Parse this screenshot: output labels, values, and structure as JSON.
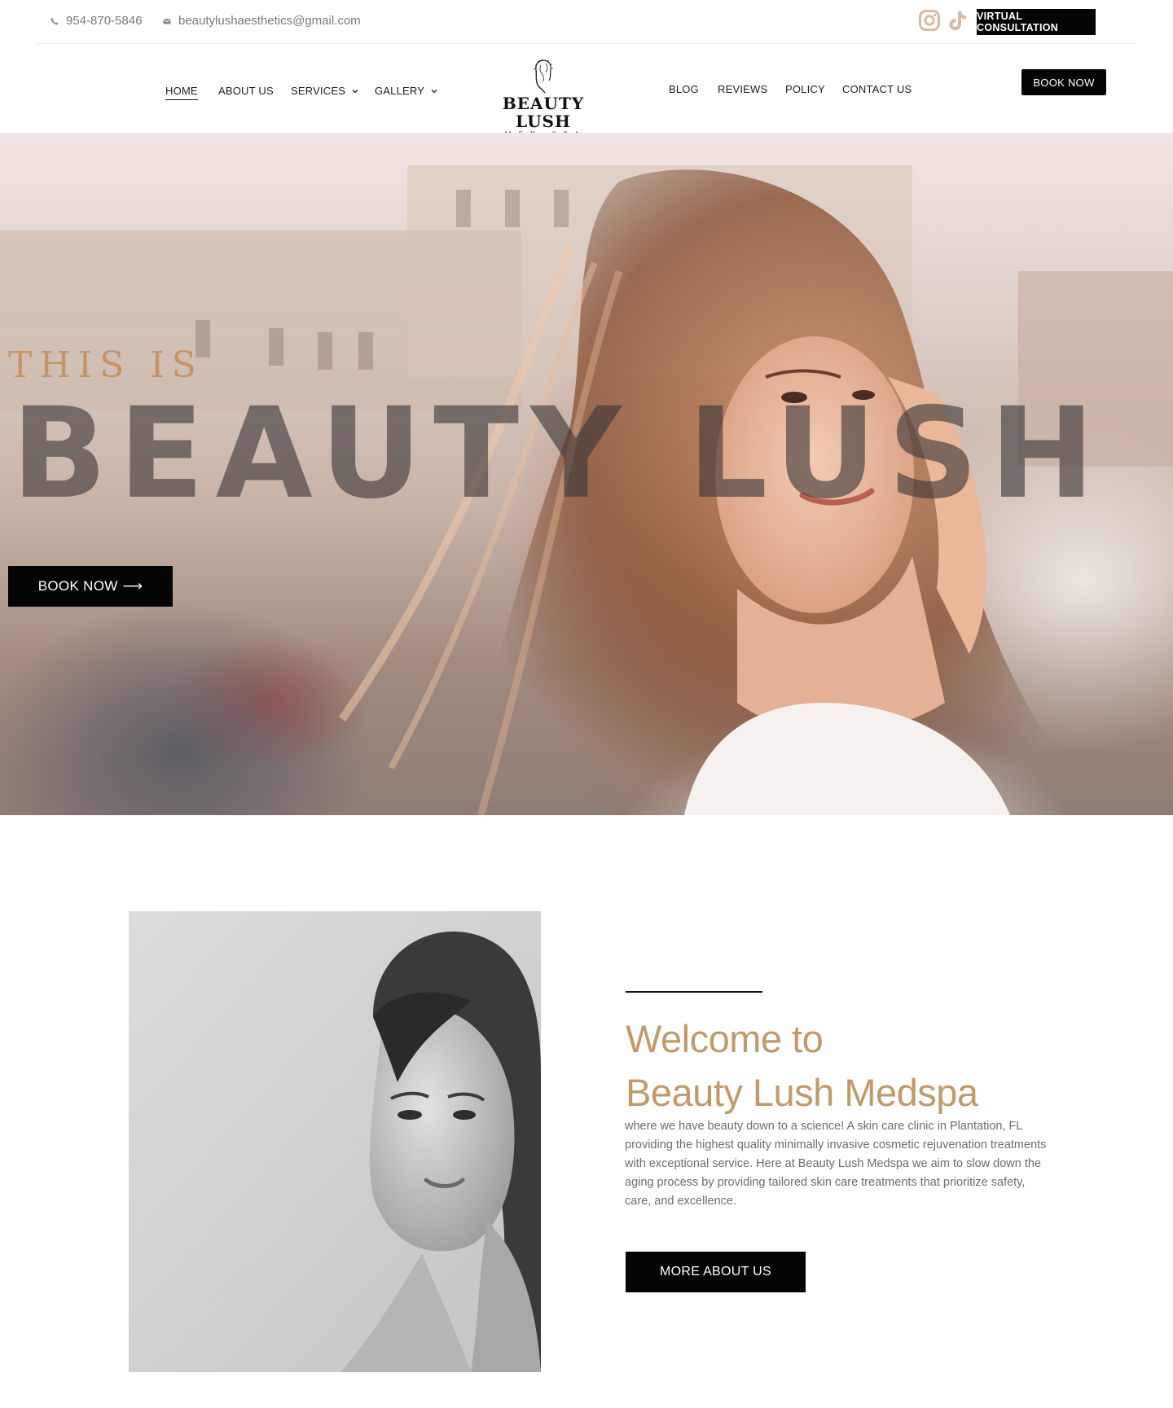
{
  "topbar": {
    "phone": "954-870-5846",
    "email": "beautylushaesthetics@gmail.com",
    "social_icons": [
      "instagram-icon",
      "tiktok-icon"
    ],
    "social_color": "#d9b9a3",
    "virtual_consultation_label": "VIRTUAL CONSULTATION"
  },
  "nav": {
    "home": "HOME",
    "about": "ABOUT US",
    "services": "SERVICES",
    "gallery": "GALLERY",
    "blog": "BLOG",
    "reviews": "REVIEWS",
    "policy": "POLICY",
    "contact": "CONTACT US",
    "book_now": "BOOK NOW"
  },
  "logo": {
    "name": "BEAUTY LUSH",
    "sub": "MED SPA"
  },
  "hero": {
    "kicker": "THIS IS",
    "title": "BEAUTY LUSH",
    "button_label": "BOOK NOW",
    "button_arrow": "⟶",
    "kicker_color": "#c28c58"
  },
  "welcome": {
    "title_line1": "Welcome to",
    "title_line2": "Beauty Lush Medspa",
    "body": "where we have beauty down to a science! A skin care clinic in Plantation, FL providing the highest quality minimally invasive cosmetic rejuvenation treatments with exceptional service. Here at Beauty Lush Medspa we aim to slow down the aging process by providing tailored skin care treatments that prioritize safety, care, and excellence.",
    "button_label": "MORE ABOUT US",
    "accent_color": "#c19a6b"
  }
}
